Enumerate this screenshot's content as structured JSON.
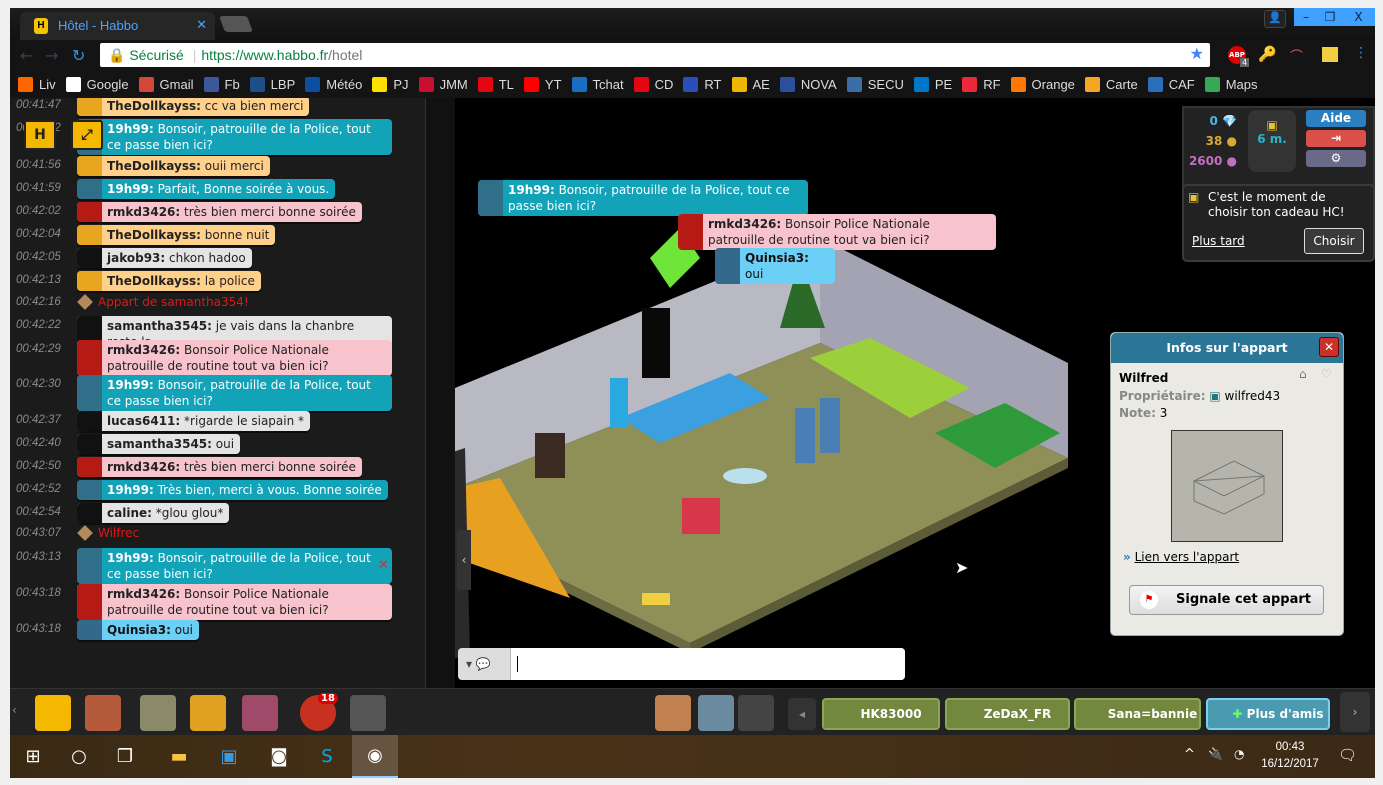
{
  "browser": {
    "tab_title": "Hôtel - Habbo",
    "secure_label": "Sécurisé",
    "url_host": "https://www.habbo.fr",
    "url_path": "/hotel",
    "abp_badge": "4"
  },
  "bookmarks": [
    {
      "label": "Liv",
      "color": "#ff6600"
    },
    {
      "label": "Google",
      "color": "#ffffff"
    },
    {
      "label": "Gmail",
      "color": "#d44638"
    },
    {
      "label": "Fb",
      "color": "#3b5998"
    },
    {
      "label": "LBP",
      "color": "#1e4d8c"
    },
    {
      "label": "Météo",
      "color": "#0b4fa0"
    },
    {
      "label": "PJ",
      "color": "#ffe100"
    },
    {
      "label": "JMM",
      "color": "#c8102e"
    },
    {
      "label": "TL",
      "color": "#e30613"
    },
    {
      "label": "YT",
      "color": "#ff0000"
    },
    {
      "label": "Tchat",
      "color": "#1a6ec0"
    },
    {
      "label": "CD",
      "color": "#e30613"
    },
    {
      "label": "RT",
      "color": "#2a4fb8"
    },
    {
      "label": "AE",
      "color": "#f2b600"
    },
    {
      "label": "NOVA",
      "color": "#2b4f9e"
    },
    {
      "label": "SECU",
      "color": "#3a6ea5"
    },
    {
      "label": "PE",
      "color": "#0077c8"
    },
    {
      "label": "RF",
      "color": "#ed2939"
    },
    {
      "label": "Orange",
      "color": "#ff7900"
    },
    {
      "label": "Carte",
      "color": "#f5a623"
    },
    {
      "label": "CAF",
      "color": "#2a6ebb"
    },
    {
      "label": "Maps",
      "color": "#34a853"
    }
  ],
  "chat": [
    {
      "time": "00:41:47",
      "user": "TheDollkayss:",
      "text": "cc va bien merci",
      "style": "orange"
    },
    {
      "time": "00:41:52",
      "user": "19h99:",
      "text": "Bonsoir, patrouille de la Police, tout ce passe bien ici?",
      "style": "teal"
    },
    {
      "time": "00:41:56",
      "user": "TheDollkayss:",
      "text": "ouii merci",
      "style": "orange"
    },
    {
      "time": "00:41:59",
      "user": "19h99:",
      "text": "Parfait, Bonne soirée à vous.",
      "style": "teal"
    },
    {
      "time": "00:42:02",
      "user": "rmkd3426:",
      "text": "très bien merci bonne soirée",
      "style": "pink"
    },
    {
      "time": "00:42:04",
      "user": "TheDollkayss:",
      "text": "bonne nuit",
      "style": "orange"
    },
    {
      "time": "00:42:05",
      "user": "jakob93:",
      "text": "chkon hadoo",
      "style": "white"
    },
    {
      "time": "00:42:13",
      "user": "TheDollkayss:",
      "text": "la police",
      "style": "orange"
    },
    {
      "time": "00:42:16",
      "system": "Appart de samantha354!"
    },
    {
      "time": "00:42:22",
      "user": "samantha3545:",
      "text": "je vais dans la chanbre reste la",
      "style": "white"
    },
    {
      "time": "00:42:29",
      "user": "rmkd3426:",
      "text": "Bonsoir Police Nationale patrouille de routine tout va bien ici?",
      "style": "pink"
    },
    {
      "time": "00:42:30",
      "user": "19h99:",
      "text": "Bonsoir, patrouille de la Police, tout ce passe bien ici?",
      "style": "teal"
    },
    {
      "time": "00:42:37",
      "user": "lucas6411:",
      "text": "*rigarde  le siapain *",
      "style": "white"
    },
    {
      "time": "00:42:40",
      "user": "samantha3545:",
      "text": "oui",
      "style": "white"
    },
    {
      "time": "00:42:50",
      "user": "rmkd3426:",
      "text": "très bien merci bonne soirée",
      "style": "pink"
    },
    {
      "time": "00:42:52",
      "user": "19h99:",
      "text": "Très bien, merci à vous. Bonne soirée",
      "style": "teal"
    },
    {
      "time": "00:42:54",
      "user": "caline:",
      "text": "*glou glou*",
      "style": "white"
    },
    {
      "time": "00:43:07",
      "system": "Wilfrec"
    },
    {
      "time": "00:43:13",
      "user": "19h99:",
      "text": "Bonsoir, patrouille de la Police, tout ce passe bien ici?",
      "style": "teal"
    },
    {
      "time": "00:43:18",
      "user": "rmkd3426:",
      "text": "Bonsoir Police Nationale patrouille de routine tout va bien ici?",
      "style": "pink"
    },
    {
      "time": "00:43:18",
      "user": "Quinsia3:",
      "text": "oui",
      "style": "blue"
    }
  ],
  "room_bubbles": [
    {
      "user": "19h99:",
      "text": "Bonsoir, patrouille de la Police, tout ce passe bien ici?",
      "style": "teal"
    },
    {
      "user": "rmkd3426:",
      "text": "Bonsoir Police Nationale patrouille de routine tout va bien ici?",
      "style": "pink"
    },
    {
      "user": "Quinsia3:",
      "text": "oui",
      "style": "blue"
    }
  ],
  "purse": {
    "diamonds": "0",
    "credits": "38",
    "duckets": "2600",
    "hc_time": "6 m.",
    "help_label": "Aide"
  },
  "hc_notice": {
    "text": "C'est le moment de choisir ton cadeau HC!",
    "later": "Plus tard",
    "choose": "Choisir"
  },
  "room_info": {
    "title": "Infos sur l'appart",
    "name": "Wilfred",
    "owner_label": "Propriétaire:",
    "owner": "wilfred43",
    "rating_label": "Note:",
    "rating": "3",
    "link": "Lien vers l'appart",
    "report": "Signale cet appart"
  },
  "toolbar": {
    "badge": "18",
    "friends": [
      "HK83000",
      "ZeDaX_FR",
      "Sana=bannie"
    ],
    "more_friends": "Plus d'amis"
  },
  "taskbar": {
    "time": "00:43",
    "date": "16/12/2017"
  }
}
